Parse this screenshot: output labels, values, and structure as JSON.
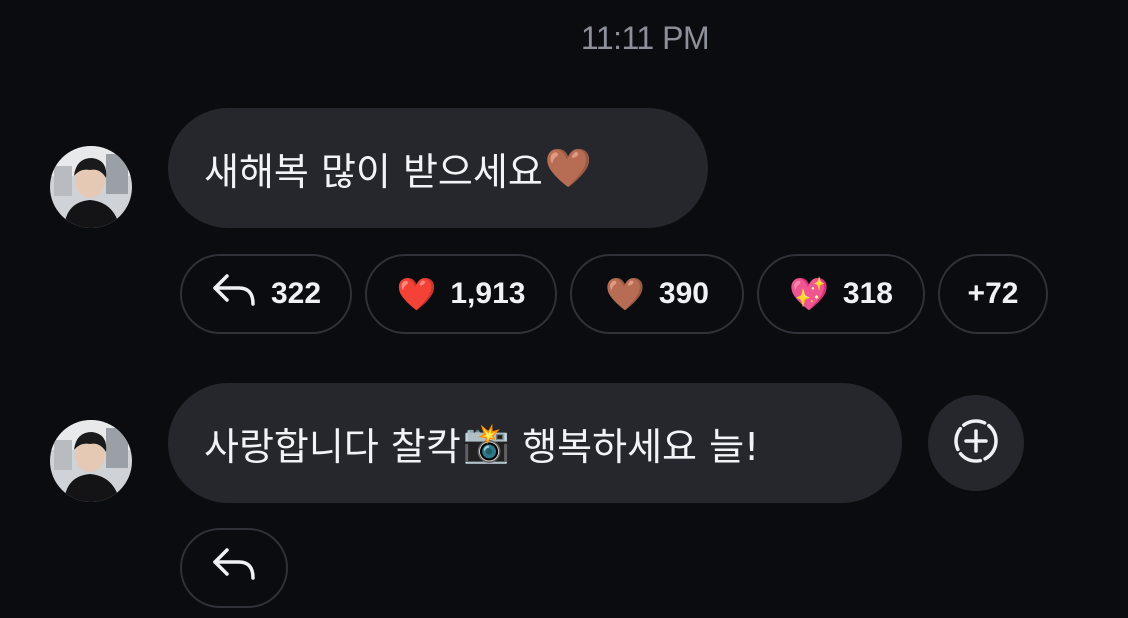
{
  "timestamp": "11:11 PM",
  "messages": [
    {
      "text": "새해복 많이 받으세요",
      "emoji": "🤎",
      "reactions": {
        "reply_count": "322",
        "items": [
          {
            "emoji": "❤️",
            "count": "1,913"
          },
          {
            "emoji": "🤎",
            "count": "390"
          },
          {
            "emoji": "💖",
            "count": "318"
          }
        ],
        "more": "+72"
      }
    },
    {
      "text_before": "사랑합니다 찰칵",
      "emoji": "📸",
      "text_after": " 행복하세요 늘!"
    }
  ],
  "icons": {
    "reply": "reply-arrow-icon",
    "add_reaction": "add-reaction-icon",
    "avatar": "avatar"
  },
  "colors": {
    "background": "#0b0c0f",
    "bubble": "#25272c",
    "chip_border": "#2f3239",
    "timestamp": "#8c9098"
  }
}
